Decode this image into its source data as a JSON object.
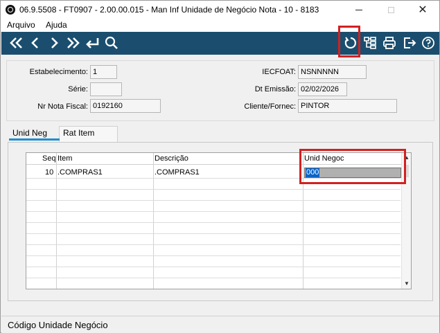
{
  "window": {
    "title": "06.9.5508 - FT0907 - 2.00.00.015 - Man Inf Unidade de Negócio Nota - 10 - 8183",
    "close_symbol": "✕"
  },
  "menu": {
    "items": [
      "Arquivo",
      "Ajuda"
    ]
  },
  "toolbar": {
    "color": "#1b4e6e",
    "icons": [
      "first-record-icon",
      "previous-record-icon",
      "next-record-icon",
      "last-record-icon",
      "goto-icon",
      "search-icon",
      "refresh-icon",
      "tree-icon",
      "print-icon",
      "exit-icon",
      "help-icon"
    ]
  },
  "form": {
    "estabelecimento": {
      "label": "Estabelecimento:",
      "value": "1"
    },
    "serie": {
      "label": "Série:",
      "value": ""
    },
    "nr_nota_fiscal": {
      "label": "Nr Nota Fiscal:",
      "value": "0192160"
    },
    "iecfoat": {
      "label": "IECFOAT:",
      "value": "NSNNNNN"
    },
    "dt_emissao": {
      "label": "Dt Emissão:",
      "value": "02/02/2026"
    },
    "cliente_fornec": {
      "label": "Cliente/Fornec:",
      "value": "PINTOR"
    }
  },
  "tabs": [
    {
      "label": "Unid Neg",
      "active": true
    },
    {
      "label": "Rat Item",
      "active": false
    }
  ],
  "grid": {
    "columns": [
      "Seq",
      "Item",
      "Descrição",
      "Unid Negoc"
    ],
    "rows": [
      {
        "seq": "10",
        "item": ".COMPRAS1",
        "descricao": ".COMPRAS1",
        "unid_negoc": "000"
      }
    ]
  },
  "statusbar": {
    "text": "Código Unidade Negócio"
  },
  "colors": {
    "highlight": "#d32020",
    "selection": "#0a64c8",
    "tab_underline": "#1a8fd0"
  }
}
